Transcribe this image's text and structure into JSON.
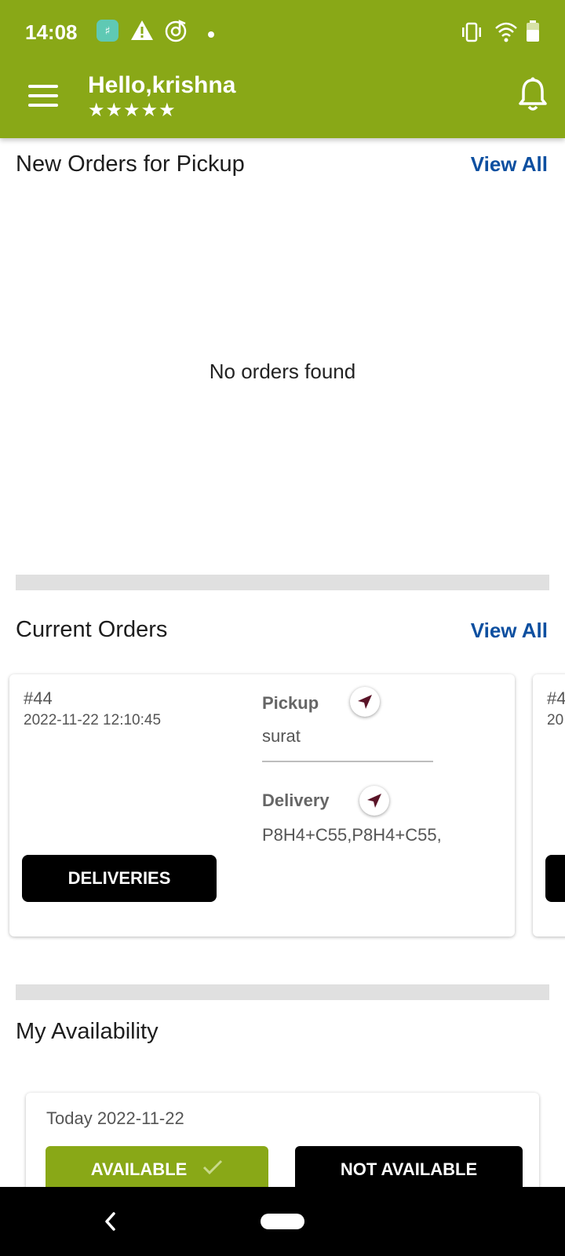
{
  "status_bar": {
    "time": "14:08",
    "icons": [
      "app-notification-icon",
      "warning-icon",
      "music-note-icon",
      "dot-icon",
      "vibrate-icon",
      "wifi-icon",
      "battery-icon"
    ]
  },
  "header": {
    "greeting": "Hello,krishna",
    "rating_stars": "★★★★★",
    "rating": 5,
    "menu_icon": "menu-icon",
    "notification_icon": "bell-icon"
  },
  "new_orders": {
    "title": "New Orders for Pickup",
    "view_all": "View All",
    "empty_message": "No orders found"
  },
  "current_orders": {
    "title": "Current Orders",
    "view_all": "View All",
    "cards": [
      {
        "id": "#44",
        "date": "2022-11-22 12:10:45",
        "pickup_label": "Pickup",
        "pickup_value": "surat",
        "delivery_label": "Delivery",
        "delivery_value": "P8H4+C55,P8H4+C55,",
        "button": "DELIVERIES"
      },
      {
        "id": "#4",
        "date": "20"
      }
    ]
  },
  "availability": {
    "title": "My Availability",
    "date_label": "Today 2022-11-22",
    "available_button": "AVAILABLE",
    "not_available_button": "NOT AVAILABLE"
  },
  "colors": {
    "primary": "#89a817",
    "link": "#0d4fa0",
    "navigate_icon": "#5a1428"
  }
}
